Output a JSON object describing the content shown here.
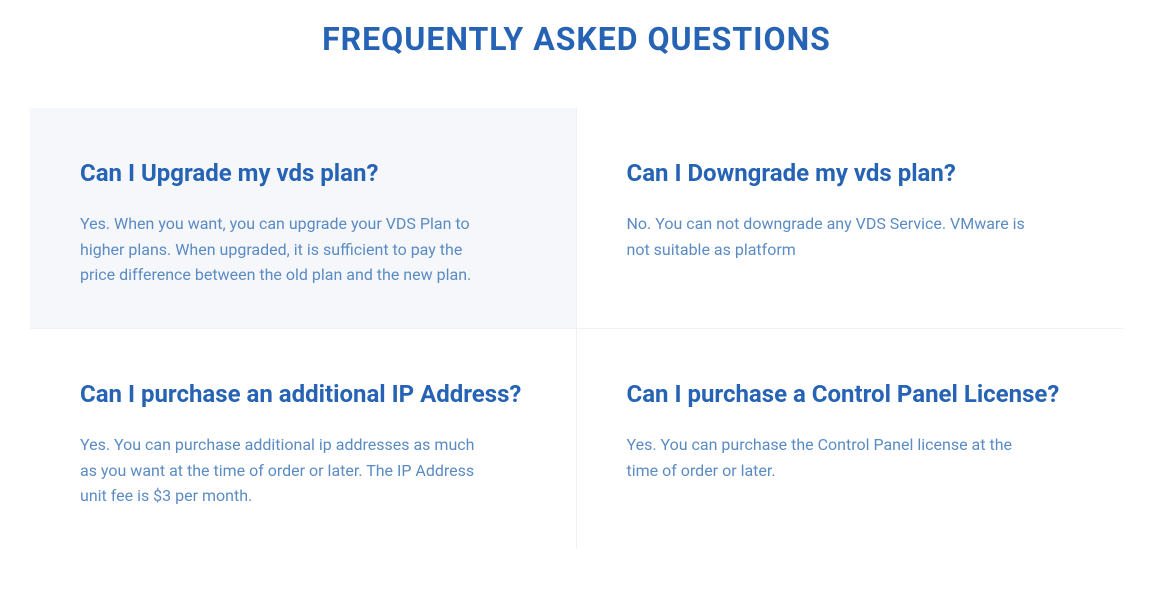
{
  "title": "FREQUENTLY ASKED QUESTIONS",
  "faqs": [
    {
      "question": "Can I Upgrade my vds plan?",
      "answer": "Yes. When you want, you can upgrade your VDS Plan to higher plans. When upgraded, it is sufficient to pay the price difference between the old plan and the new plan."
    },
    {
      "question": "Can I Downgrade my vds plan?",
      "answer": "No. You can not downgrade any VDS Service. VMware is not suitable as platform"
    },
    {
      "question": "Can I purchase an additional IP Address?",
      "answer": "Yes. You can purchase additional ip addresses as much as you want at the time of order or later. The IP Address unit fee is $3 per month."
    },
    {
      "question": "Can I purchase a Control Panel License?",
      "answer": "Yes. You can purchase the Control Panel license at the time of order or later."
    }
  ]
}
